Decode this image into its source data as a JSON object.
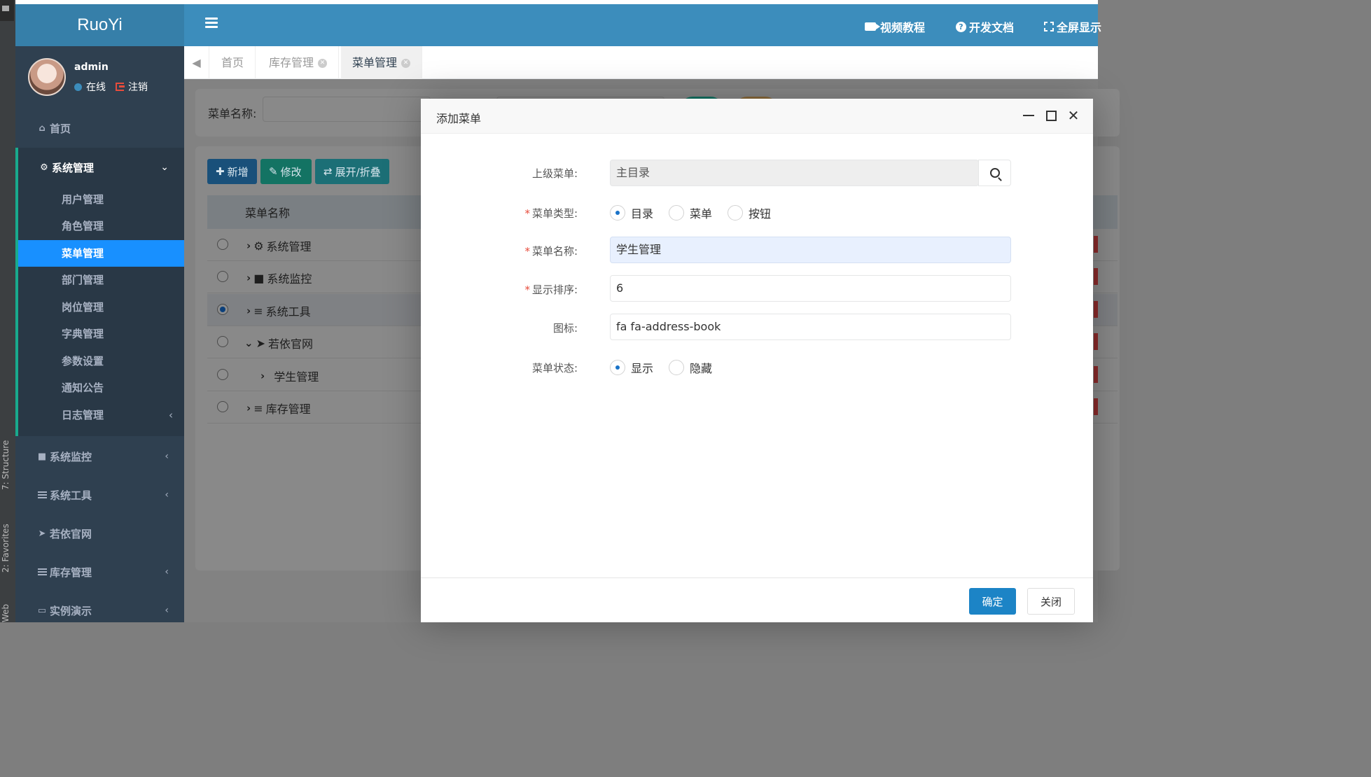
{
  "ide": {
    "structure_label": "7: Structure",
    "favorites_label": "2: Favorites",
    "web_label": "Web"
  },
  "header": {
    "logo": "RuoYi",
    "links": {
      "video": "视频教程",
      "docs": "开发文档",
      "fullscreen": "全屏显示"
    }
  },
  "user": {
    "name": "admin",
    "status": "在线",
    "logout": "注销"
  },
  "sidebar": {
    "home": "首页",
    "system": "系统管理",
    "sub_items": [
      "用户管理",
      "角色管理",
      "菜单管理",
      "部门管理",
      "岗位管理",
      "字典管理",
      "参数设置",
      "通知公告",
      "日志管理"
    ],
    "monitor": "系统监控",
    "tools": "系统工具",
    "ruoyi": "若依官网",
    "inventory": "库存管理",
    "demo": "实例演示"
  },
  "tabs": [
    "首页",
    "库存管理",
    "菜单管理"
  ],
  "search": {
    "label": "菜单名称:"
  },
  "toolbar": {
    "add": "新增",
    "edit": "修改",
    "expand": "展开/折叠"
  },
  "table": {
    "header": "菜单名称",
    "rows": [
      "系统管理",
      "系统监控",
      "系统工具",
      "若依官网",
      "学生管理",
      "库存管理"
    ]
  },
  "modal": {
    "title": "添加菜单",
    "parent_label": "上级菜单:",
    "parent_value": "主目录",
    "type_label": "菜单类型:",
    "type_options": [
      "目录",
      "菜单",
      "按钮"
    ],
    "type_selected": "目录",
    "name_label": "菜单名称:",
    "name_value": "学生管理",
    "order_label": "显示排序:",
    "order_value": "6",
    "icon_label": "图标:",
    "icon_value": "fa fa-address-book",
    "status_label": "菜单状态:",
    "status_options": [
      "显示",
      "隐藏"
    ],
    "status_selected": "显示",
    "ok": "确定",
    "close": "关闭"
  },
  "colors": {
    "header": "#3c8dbc",
    "logo": "#367fa9",
    "sidebar": "#2f4050",
    "active": "#1890ff",
    "primary": "#1c84c6"
  }
}
